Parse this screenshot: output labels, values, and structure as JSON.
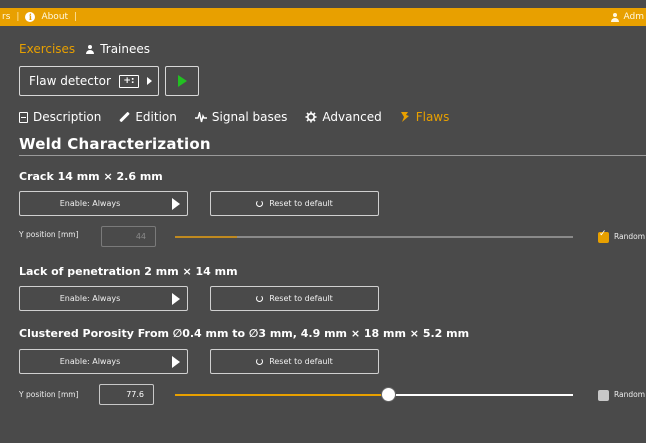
{
  "topbar": {
    "crumb_start": "rs",
    "about_label": "About",
    "user_label": "Adm"
  },
  "main_tabs": {
    "exercises": "Exercises",
    "trainees": "Trainees"
  },
  "detector": {
    "label": "Flaw detector",
    "icon_text": "+:"
  },
  "subtabs": {
    "description": "Description",
    "edition": "Edition",
    "signal_bases": "Signal bases",
    "advanced": "Advanced",
    "flaws": "Flaws"
  },
  "section_title": "Weld Characterization",
  "flaws": [
    {
      "title": "Crack 14 mm × 2.6 mm",
      "enable_label": "Enable: Always",
      "reset_label": "Reset to default",
      "y_label": "Y position [mm]",
      "y_value": "44",
      "random_label": "Random",
      "random_checked": true
    },
    {
      "title": "Lack of penetration 2 mm × 14 mm",
      "enable_label": "Enable: Always",
      "reset_label": "Reset to default"
    },
    {
      "title": "Clustered Porosity From ∅0.4 mm to ∅3 mm, 4.9 mm × 18 mm × 5.2 mm",
      "enable_label": "Enable: Always",
      "reset_label": "Reset to default",
      "y_label": "Y position [mm]",
      "y_value": "77.6",
      "random_label": "Random",
      "random_checked": false
    }
  ],
  "colors": {
    "accent": "#e8a000",
    "background": "#4a4a4a",
    "play_green": "#22c022"
  }
}
